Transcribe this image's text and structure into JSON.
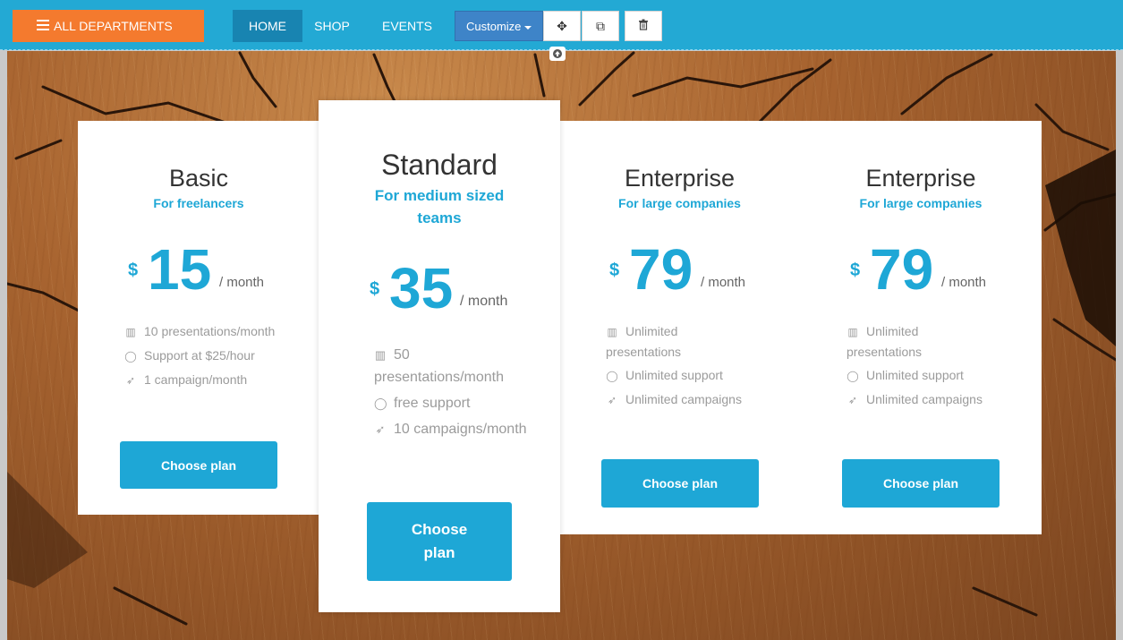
{
  "nav": {
    "departments_label": "ALL DEPARTMENTS",
    "items": [
      {
        "label": "HOME"
      },
      {
        "label": "SHOP"
      },
      {
        "label": "EVENTS"
      }
    ],
    "customize_label": "Customize",
    "tools": [
      {
        "icon": "move-icon",
        "glyph": "✥"
      },
      {
        "icon": "copy-icon",
        "glyph": "⧉"
      },
      {
        "icon": "trash-icon",
        "glyph": "🗑"
      }
    ],
    "handle_icon": "arrow-up-icon"
  },
  "plans": [
    {
      "name": "Basic",
      "subtitle": "For freelancers",
      "currency": "$",
      "amount": "15",
      "period": "/ month",
      "features": [
        {
          "icon": "chart-icon",
          "text": "10 presentations/month"
        },
        {
          "icon": "chat-icon",
          "text": "Support at $25/hour"
        },
        {
          "icon": "rocket-icon",
          "text": "1 campaign/month"
        }
      ],
      "button": "Choose plan"
    },
    {
      "name": "Standard",
      "subtitle": "For medium sized teams",
      "currency": "$",
      "amount": "35",
      "period": "/ month",
      "features": [
        {
          "icon": "chart-icon",
          "text": "50 presentations/month"
        },
        {
          "icon": "chat-icon",
          "text": "free support"
        },
        {
          "icon": "rocket-icon",
          "text": "10 campaigns/month"
        }
      ],
      "button": "Choose plan"
    },
    {
      "name": "Enterprise",
      "subtitle": "For large companies",
      "currency": "$",
      "amount": "79",
      "period": "/ month",
      "features": [
        {
          "icon": "chart-icon",
          "text": "Unlimited presentations"
        },
        {
          "icon": "chat-icon",
          "text": "Unlimited support"
        },
        {
          "icon": "rocket-icon",
          "text": "Unlimited campaigns"
        }
      ],
      "button": "Choose plan"
    },
    {
      "name": "Enterprise",
      "subtitle": "For large companies",
      "currency": "$",
      "amount": "79",
      "period": "/ month",
      "features": [
        {
          "icon": "chart-icon",
          "text": "Unlimited presentations"
        },
        {
          "icon": "chat-icon",
          "text": "Unlimited support"
        },
        {
          "icon": "rocket-icon",
          "text": "Unlimited campaigns"
        }
      ],
      "button": "Choose plan"
    }
  ],
  "colors": {
    "nav_bg": "#23a9d4",
    "departments_bg": "#f47a2e",
    "active_nav_bg": "#1884b1",
    "accent": "#1ea7d6"
  }
}
